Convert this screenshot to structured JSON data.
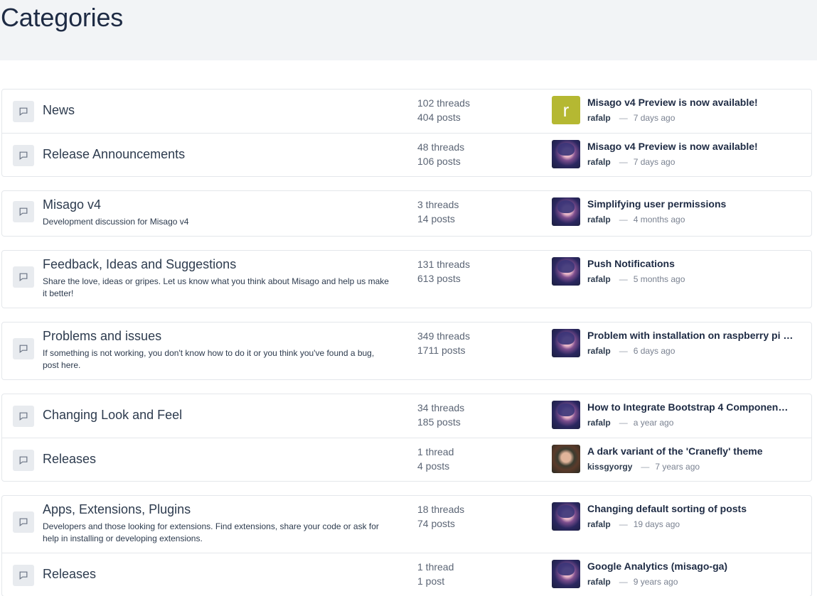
{
  "page": {
    "title": "Categories"
  },
  "icons": {
    "category": "chat-bubble-icon"
  },
  "colors": {
    "header_bg": "#f2f4f6",
    "letter_avatar_bg": "#b5b832",
    "border": "#e4e7eb"
  },
  "groups": [
    {
      "rows": [
        {
          "name": "News",
          "description": "",
          "threads": "102 threads",
          "posts": "404 posts",
          "avatar": {
            "type": "letter",
            "letter": "r"
          },
          "last_title": "Misago v4 Preview is now available!",
          "poster": "rafalp",
          "dash": "—",
          "time": "7 days ago"
        },
        {
          "name": "Release Announcements",
          "description": "",
          "threads": "48 threads",
          "posts": "106 posts",
          "avatar": {
            "type": "anime"
          },
          "last_title": "Misago v4 Preview is now available!",
          "poster": "rafalp",
          "dash": "—",
          "time": "7 days ago"
        }
      ]
    },
    {
      "rows": [
        {
          "name": "Misago v4",
          "description": "Development discussion for Misago v4",
          "threads": "3 threads",
          "posts": "14 posts",
          "avatar": {
            "type": "anime"
          },
          "last_title": "Simplifying user permissions",
          "poster": "rafalp",
          "dash": "—",
          "time": "4 months ago"
        }
      ]
    },
    {
      "rows": [
        {
          "name": "Feedback, Ideas and Suggestions",
          "description": "Share the love, ideas or gripes. Let us know what you think about Misago and help us make it better!",
          "threads": "131 threads",
          "posts": "613 posts",
          "avatar": {
            "type": "anime"
          },
          "last_title": "Push Notifications",
          "poster": "rafalp",
          "dash": "—",
          "time": "5 months ago"
        }
      ]
    },
    {
      "rows": [
        {
          "name": "Problems and issues",
          "description": "If something is not working, you don't know how to do it or you think you've found a bug, post here.",
          "threads": "349 threads",
          "posts": "1711 posts",
          "avatar": {
            "type": "anime"
          },
          "last_title": "Problem with installation on raspberry pi …",
          "poster": "rafalp",
          "dash": "—",
          "time": "6 days ago"
        }
      ]
    },
    {
      "rows": [
        {
          "name": "Changing Look and Feel",
          "description": "",
          "threads": "34 threads",
          "posts": "185 posts",
          "avatar": {
            "type": "anime"
          },
          "last_title": "How to Integrate Bootstrap 4 Componen…",
          "poster": "rafalp",
          "dash": "—",
          "time": "a year ago"
        },
        {
          "name": "Releases",
          "description": "",
          "threads": "1 thread",
          "posts": "4 posts",
          "avatar": {
            "type": "photo"
          },
          "last_title": "A dark variant of the 'Cranefly' theme",
          "poster": "kissgyorgy",
          "dash": "—",
          "time": "7 years ago"
        }
      ]
    },
    {
      "rows": [
        {
          "name": "Apps, Extensions, Plugins",
          "description": "Developers and those looking for extensions. Find extensions, share your code or ask for help in installing or developing extensions.",
          "threads": "18 threads",
          "posts": "74 posts",
          "avatar": {
            "type": "anime"
          },
          "last_title": "Changing default sorting of posts",
          "poster": "rafalp",
          "dash": "—",
          "time": "19 days ago"
        },
        {
          "name": "Releases",
          "description": "",
          "threads": "1 thread",
          "posts": "1 post",
          "avatar": {
            "type": "anime"
          },
          "last_title": "Google Analytics (misago-ga)",
          "poster": "rafalp",
          "dash": "—",
          "time": "9 years ago"
        }
      ]
    }
  ]
}
